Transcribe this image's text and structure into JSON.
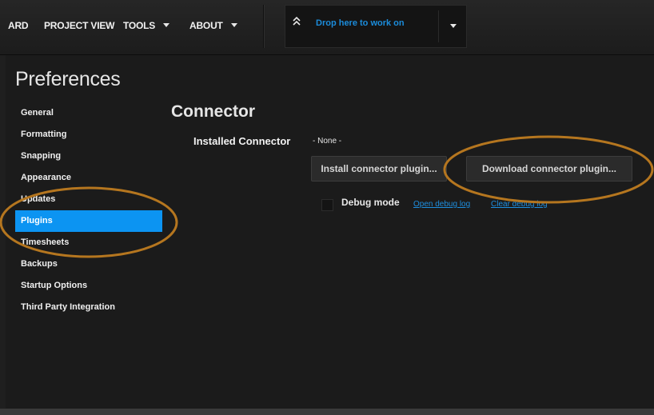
{
  "menu": {
    "items": [
      {
        "label": "ARD",
        "has_caret": false
      },
      {
        "label": "PROJECT VIEW",
        "has_caret": false
      },
      {
        "label": "TOOLS",
        "has_caret": true
      },
      {
        "label": "ABOUT",
        "has_caret": true
      }
    ],
    "drop_zone": {
      "label": "Drop here to work on",
      "icon": "double-chevron-up-icon",
      "menu_icon": "chevron-down-icon"
    }
  },
  "preferences": {
    "title": "Preferences",
    "sidebar": [
      {
        "label": "General"
      },
      {
        "label": "Formatting"
      },
      {
        "label": "Snapping"
      },
      {
        "label": "Appearance"
      },
      {
        "label": "Updates"
      },
      {
        "label": "Plugins",
        "selected": true
      },
      {
        "label": "Timesheets"
      },
      {
        "label": "Backups"
      },
      {
        "label": "Startup Options"
      },
      {
        "label": "Third Party Integration"
      }
    ]
  },
  "connector": {
    "title": "Connector",
    "installed_label": "Installed Connector",
    "installed_value": "- None -",
    "install_button": "Install connector plugin...",
    "download_button": "Download connector plugin...",
    "debug_mode_label": "Debug mode",
    "debug_mode_checked": false,
    "open_debug_log": "Open debug log",
    "clear_debug_log": "Clear debug log"
  },
  "colors": {
    "background": "#1b1b1b",
    "selection": "#0c94f2",
    "link": "#1e8fe0",
    "annotation": "#b5761f"
  }
}
